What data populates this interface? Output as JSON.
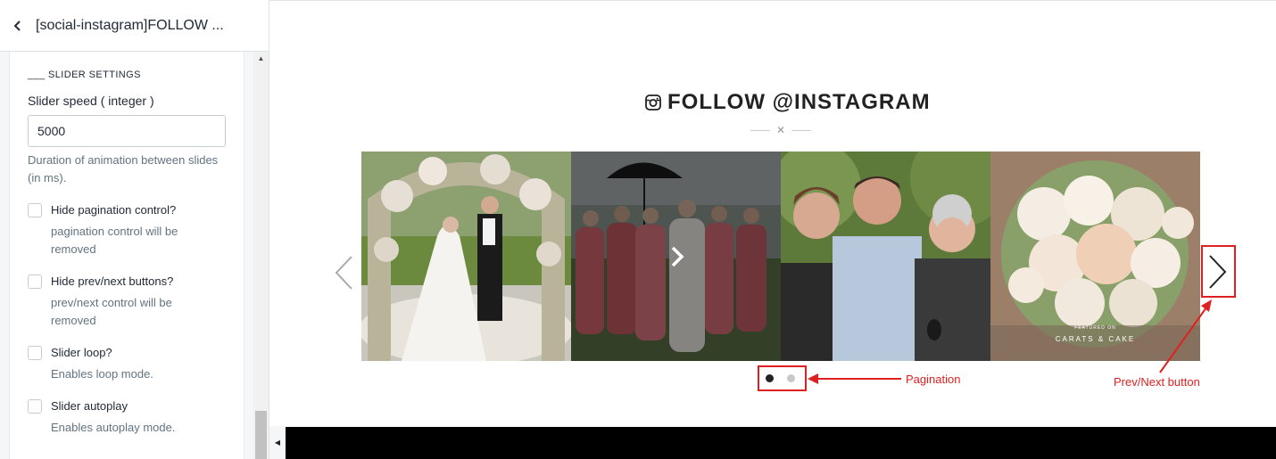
{
  "panel": {
    "title": "[social-instagram]FOLLOW ...",
    "section_heading": "___ SLIDER SETTINGS",
    "speed_label": "Slider speed ( integer )",
    "speed_value": "5000",
    "speed_help": "Duration of animation between slides (in ms).",
    "checkboxes": [
      {
        "label": "Hide pagination control?",
        "help": "pagination control will be removed",
        "checked": false
      },
      {
        "label": "Hide prev/next buttons?",
        "help": "prev/next control will be removed",
        "checked": false
      },
      {
        "label": "Slider loop?",
        "help": "Enables loop mode.",
        "checked": false
      },
      {
        "label": "Slider autoplay",
        "help": "Enables autoplay mode.",
        "checked": false
      }
    ]
  },
  "preview": {
    "heading": "FOLLOW @INSTAGRAM",
    "slides": [
      {
        "subject": "wedding-couple-arch"
      },
      {
        "subject": "bridal-party-umbrella"
      },
      {
        "subject": "family-portrait"
      },
      {
        "subject": "flower-bouquet",
        "caption_small": "FEATURED ON",
        "caption": "CARATS & CAKE"
      }
    ],
    "pagination": {
      "count": 2,
      "active": 1
    },
    "annotations": {
      "pagination": "Pagination",
      "prev_next": "Prev/Next button"
    },
    "annotation_color": "#e02020"
  }
}
